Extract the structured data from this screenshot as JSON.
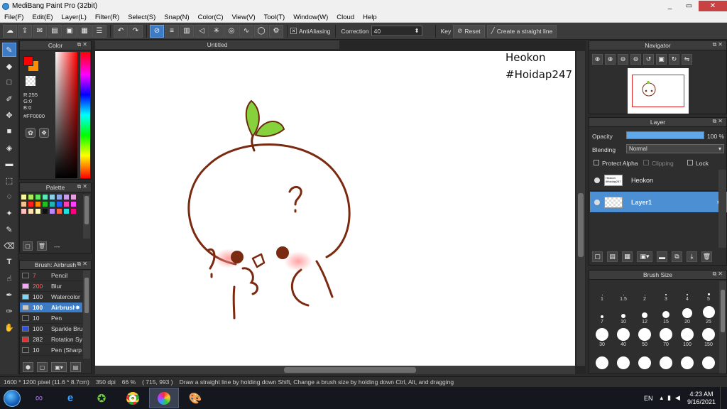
{
  "window": {
    "title": "MediBang Paint Pro (32bit)",
    "min": "_",
    "max": "▭",
    "close": "✕"
  },
  "menu": [
    "File(F)",
    "Edit(E)",
    "Layer(L)",
    "Filter(R)",
    "Select(S)",
    "Snap(N)",
    "Color(C)",
    "View(V)",
    "Tool(T)",
    "Window(W)",
    "Cloud",
    "Help"
  ],
  "toolbar": {
    "antialiasing": "AntiAliasing",
    "correction_label": "Correction",
    "correction_value": "40",
    "key_label": "Key",
    "reset_label": "Reset",
    "straight_line": "Create a straight line"
  },
  "color_panel": {
    "title": "Color",
    "r": "R:255",
    "g": "G:0",
    "b": "B:0",
    "hex": "#FF0000",
    "primary": "#ff0000",
    "secondary": "#ff8c00"
  },
  "palette_panel": {
    "title": "Palette",
    "dash": "---",
    "swatches": [
      "#f7f79c",
      "#b0e85c",
      "#5de85d",
      "#5de8b7",
      "#8ccfe8",
      "#8fa6e8",
      "#c99de8",
      "#e89ddf",
      "#f7c28c",
      "#ff2020",
      "#ff8800",
      "#20c020",
      "#1fb5b5",
      "#2060ff",
      "#ff3fb2",
      "#ff40ff",
      "#ffc0c0",
      "#ffe0b0",
      "#fffcc0",
      "#101010",
      "#bb88ff",
      "#ff6644",
      "#20e0e0",
      "#ff0080"
    ]
  },
  "brush_panel": {
    "title": "Brush: Airbrush",
    "items": [
      {
        "size": "7",
        "name": "Pencil",
        "color": "#2a2a2a"
      },
      {
        "size": "200",
        "name": "Blur",
        "color": "#f4a8f4"
      },
      {
        "size": "100",
        "name": "Watercolor",
        "color": "#7fd6f2"
      },
      {
        "size": "100",
        "name": "Airbrush",
        "color": "#c8c8c8"
      },
      {
        "size": "10",
        "name": "Pen",
        "color": "#2a2a2a"
      },
      {
        "size": "100",
        "name": "Sparkle Bru",
        "color": "#3050e0"
      },
      {
        "size": "282",
        "name": "Rotation Sy",
        "color": "#e03030"
      },
      {
        "size": "10",
        "name": "Pen (Sharp",
        "color": "#2a2a2a"
      }
    ]
  },
  "canvas": {
    "tab": "Untitled",
    "text1": "Heokon",
    "text2": "#Hoidap247"
  },
  "navigator": {
    "title": "Navigator"
  },
  "layer_panel": {
    "title": "Layer",
    "opacity_label": "Opacity",
    "opacity_value": "100 %",
    "blending_label": "Blending",
    "blending_value": "Normal",
    "protect_alpha": "Protect Alpha",
    "clipping": "Clipping",
    "lock": "Lock",
    "layers": [
      {
        "name": "Heokon"
      },
      {
        "name": "Layer1"
      }
    ],
    "thumb_text": "Heokon #Hoidap247"
  },
  "brush_size_panel": {
    "title": "Brush Size",
    "sizes": [
      {
        "label": "1",
        "d": 1
      },
      {
        "label": "1.5",
        "d": 1
      },
      {
        "label": "2",
        "d": 1
      },
      {
        "label": "3",
        "d": 2
      },
      {
        "label": "4",
        "d": 2
      },
      {
        "label": "5",
        "d": 3
      },
      {
        "label": "7",
        "d": 4
      },
      {
        "label": "10",
        "d": 6
      },
      {
        "label": "12",
        "d": 8
      },
      {
        "label": "15",
        "d": 10
      },
      {
        "label": "20",
        "d": 14
      },
      {
        "label": "25",
        "d": 17
      },
      {
        "label": "30",
        "d": 18
      },
      {
        "label": "40",
        "d": 18
      },
      {
        "label": "50",
        "d": 18
      },
      {
        "label": "70",
        "d": 18
      },
      {
        "label": "100",
        "d": 18
      },
      {
        "label": "150",
        "d": 18
      },
      {
        "label": "",
        "d": 18
      },
      {
        "label": "",
        "d": 18
      },
      {
        "label": "",
        "d": 18
      },
      {
        "label": "",
        "d": 18
      },
      {
        "label": "",
        "d": 18
      },
      {
        "label": "",
        "d": 18
      }
    ]
  },
  "status": {
    "size": "1600 * 1200 pixel",
    "dims": "(11.6 * 8.7cm)",
    "dpi": "350 dpi",
    "zoom": "66 %",
    "coords": "( 715, 993 )",
    "hint": "Draw a straight line by holding down Shift, Change a brush size by holding down Ctrl, Alt, and dragging"
  },
  "taskbar": {
    "lang": "EN",
    "time": "4:23 AM",
    "date": "9/16/2021"
  }
}
